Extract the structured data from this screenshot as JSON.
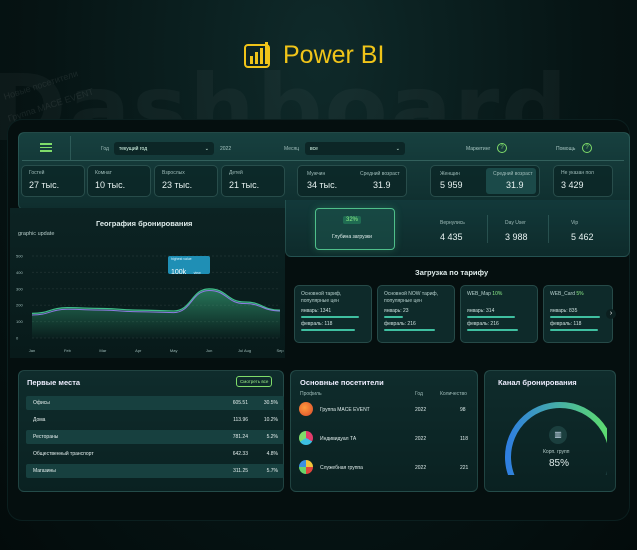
{
  "app": {
    "name": "Power BI",
    "bg_word": "Dashboard",
    "bg_small_1": "Новые посетители",
    "bg_small_2": "Группа MACE EVENT"
  },
  "filters": {
    "year_label": "Год",
    "year_select": "текущий год",
    "year_value": "2022",
    "month_label": "Месяц",
    "month_select": "все",
    "marketing": "Маркетинг",
    "help": "Помощь"
  },
  "kpis": [
    {
      "label": "Гостей",
      "value": "27 тыс."
    },
    {
      "label": "Комнат",
      "value": "10 тыс."
    },
    {
      "label": "Взрослых",
      "value": "23 тыс."
    },
    {
      "label": "Детей",
      "value": "21 тыс."
    },
    {
      "label": "Мужчин",
      "value": "34 тыс."
    },
    {
      "label": "Средний возраст",
      "value": "31.9"
    },
    {
      "label": "Женщин",
      "value": "5 959"
    },
    {
      "label": "Средний возраст",
      "value": "31.9"
    },
    {
      "label": "Не указан пол",
      "value": "3 429"
    }
  ],
  "depth": {
    "value": "32%",
    "label": "Глубина загрузки"
  },
  "stats": [
    {
      "label": "Вернулись",
      "value": "4 435"
    },
    {
      "label": "Day User",
      "value": "3 988"
    },
    {
      "label": "Vip",
      "value": "5 462"
    }
  ],
  "geo": {
    "title": "География бронирования",
    "subtitle": "graphic update",
    "tooltip_label": "highest value",
    "tooltip_value": "100k",
    "tooltip_suffix": "view"
  },
  "chart_data": {
    "type": "area",
    "title": "География бронирования",
    "categories": [
      "Jan",
      "Feb",
      "Mar",
      "Apr",
      "May",
      "Jun",
      "Jul Aug",
      "Sep"
    ],
    "y_ticks": [
      "500",
      "400",
      "300",
      "200",
      "100",
      "0"
    ],
    "ylim": [
      0,
      500
    ],
    "series": [
      {
        "values": [
          140,
          175,
          170,
          160,
          155,
          290,
          210,
          165
        ]
      },
      {
        "values": [
          150,
          185,
          180,
          170,
          165,
          300,
          220,
          170
        ]
      }
    ]
  },
  "tariffs": {
    "title": "Загрузка по тарифу",
    "items": [
      {
        "name": "Основной тариф, популярные цен",
        "pct": "",
        "jan_label": "январь:",
        "jan": "1341",
        "feb_label": "февраль:",
        "feb": "118",
        "jan_fill": 0.9,
        "feb_fill": 0.85
      },
      {
        "name": "Основной NOW тариф, популярные цен",
        "pct": "",
        "jan_label": "январь:",
        "jan": "23",
        "feb_label": "февраль:",
        "feb": "216",
        "jan_fill": 0.3,
        "feb_fill": 0.8
      },
      {
        "name": "WEB_Map",
        "pct": "10%",
        "jan_label": "январь:",
        "jan": "314",
        "feb_label": "февраль:",
        "feb": "216",
        "jan_fill": 0.75,
        "feb_fill": 0.8
      },
      {
        "name": "WEB_Card",
        "pct": "5%",
        "jan_label": "январь:",
        "jan": "835",
        "feb_label": "февраль:",
        "feb": "118",
        "jan_fill": 0.9,
        "feb_fill": 0.85
      }
    ]
  },
  "places": {
    "title": "Первые места",
    "button": "Смотреть все",
    "rows": [
      {
        "name": "Офисы",
        "a": "605.51",
        "b": "30.5%"
      },
      {
        "name": "Дома",
        "a": "113.96",
        "b": "10.2%"
      },
      {
        "name": "Рестораны",
        "a": "781.24",
        "b": "5.2%"
      },
      {
        "name": "Общественный транспорт",
        "a": "642.33",
        "b": "4.8%"
      },
      {
        "name": "Магазины",
        "a": "311.25",
        "b": "5.7%"
      }
    ]
  },
  "visitors": {
    "title": "Основные посетители",
    "col_profile": "Профиль",
    "col_year": "Год",
    "col_count": "Количество",
    "rows": [
      {
        "name": "Группа MACE EVENT",
        "year": "2022",
        "count": "98"
      },
      {
        "name": "Индивидуал ТА",
        "year": "2022",
        "count": "118"
      },
      {
        "name": "Служебная группа",
        "year": "2022",
        "count": "221"
      }
    ]
  },
  "channel": {
    "title": "Канал бронирования",
    "label": "Корп. групп",
    "value": "85%",
    "level": 0.85
  },
  "colors": {
    "accent_green": "#7fdc6a",
    "teal": "#3fbfa0",
    "logo_yellow": "#f0c419"
  }
}
